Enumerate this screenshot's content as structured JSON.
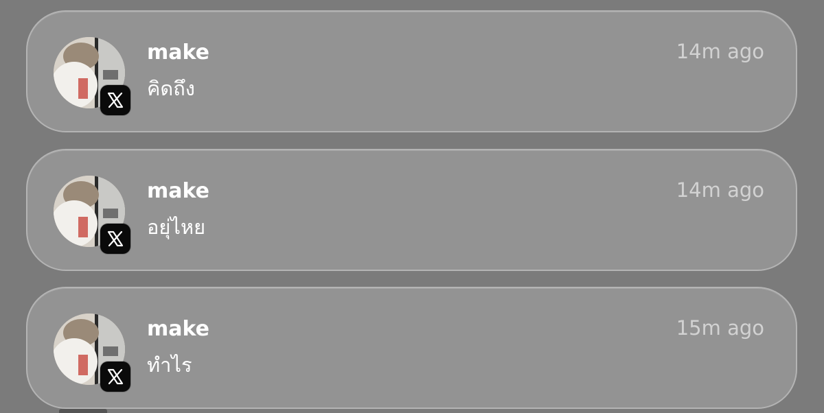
{
  "notifications": [
    {
      "sender": "make",
      "message": "คิดถึง",
      "time": "14m ago",
      "app_icon": "x-logo-icon"
    },
    {
      "sender": "make",
      "message": "อยุ่ไหย",
      "time": "14m ago",
      "app_icon": "x-logo-icon"
    },
    {
      "sender": "make",
      "message": "ทำไร",
      "time": "15m ago",
      "app_icon": "x-logo-icon"
    }
  ],
  "colors": {
    "background": "#7b7b7b",
    "card": "#939393",
    "card_border": "#b4b4b4",
    "text_primary": "#ffffff",
    "text_time": "#d2d2d2",
    "badge_background": "#0a0a0a"
  }
}
